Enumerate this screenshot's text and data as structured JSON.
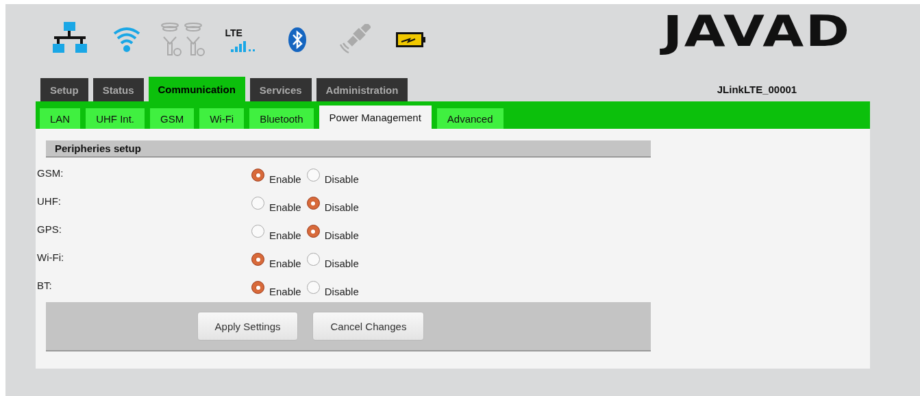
{
  "status_icons": [
    {
      "kind": "network",
      "active": true
    },
    {
      "kind": "wifi",
      "active": true
    },
    {
      "kind": "uhf",
      "active": false
    },
    {
      "kind": "lte",
      "active": true,
      "label": "LTE"
    },
    {
      "kind": "bluetooth",
      "active": true
    },
    {
      "kind": "satellite",
      "active": false
    },
    {
      "kind": "battery",
      "active": true
    }
  ],
  "logo": "JAVAD",
  "device_name": "JLinkLTE_00001",
  "main_tabs": [
    {
      "label": "Setup",
      "selected": false
    },
    {
      "label": "Status",
      "selected": false
    },
    {
      "label": "Communication",
      "selected": true
    },
    {
      "label": "Services",
      "selected": false
    },
    {
      "label": "Administration",
      "selected": false
    }
  ],
  "sub_tabs": [
    {
      "label": "LAN",
      "selected": false
    },
    {
      "label": "UHF Int.",
      "selected": false
    },
    {
      "label": "GSM",
      "selected": false
    },
    {
      "label": "Wi-Fi",
      "selected": false
    },
    {
      "label": "Bluetooth",
      "selected": false
    },
    {
      "label": "Power Management",
      "selected": true
    },
    {
      "label": "Advanced",
      "selected": false
    }
  ],
  "section": {
    "title": "Peripheries setup",
    "rows": [
      {
        "label": "GSM:",
        "options": [
          {
            "label": "Enable",
            "selected": true
          },
          {
            "label": "Disable",
            "selected": false
          }
        ]
      },
      {
        "label": "UHF:",
        "options": [
          {
            "label": "Enable",
            "selected": false
          },
          {
            "label": "Disable",
            "selected": true
          }
        ]
      },
      {
        "label": "GPS:",
        "options": [
          {
            "label": "Enable",
            "selected": false
          },
          {
            "label": "Disable",
            "selected": true
          }
        ]
      },
      {
        "label": "Wi-Fi:",
        "options": [
          {
            "label": "Enable",
            "selected": true
          },
          {
            "label": "Disable",
            "selected": false
          }
        ]
      },
      {
        "label": "BT:",
        "options": [
          {
            "label": "Enable",
            "selected": true
          },
          {
            "label": "Disable",
            "selected": false
          }
        ]
      }
    ]
  },
  "buttons": [
    "Apply Settings",
    "Cancel Changes"
  ]
}
